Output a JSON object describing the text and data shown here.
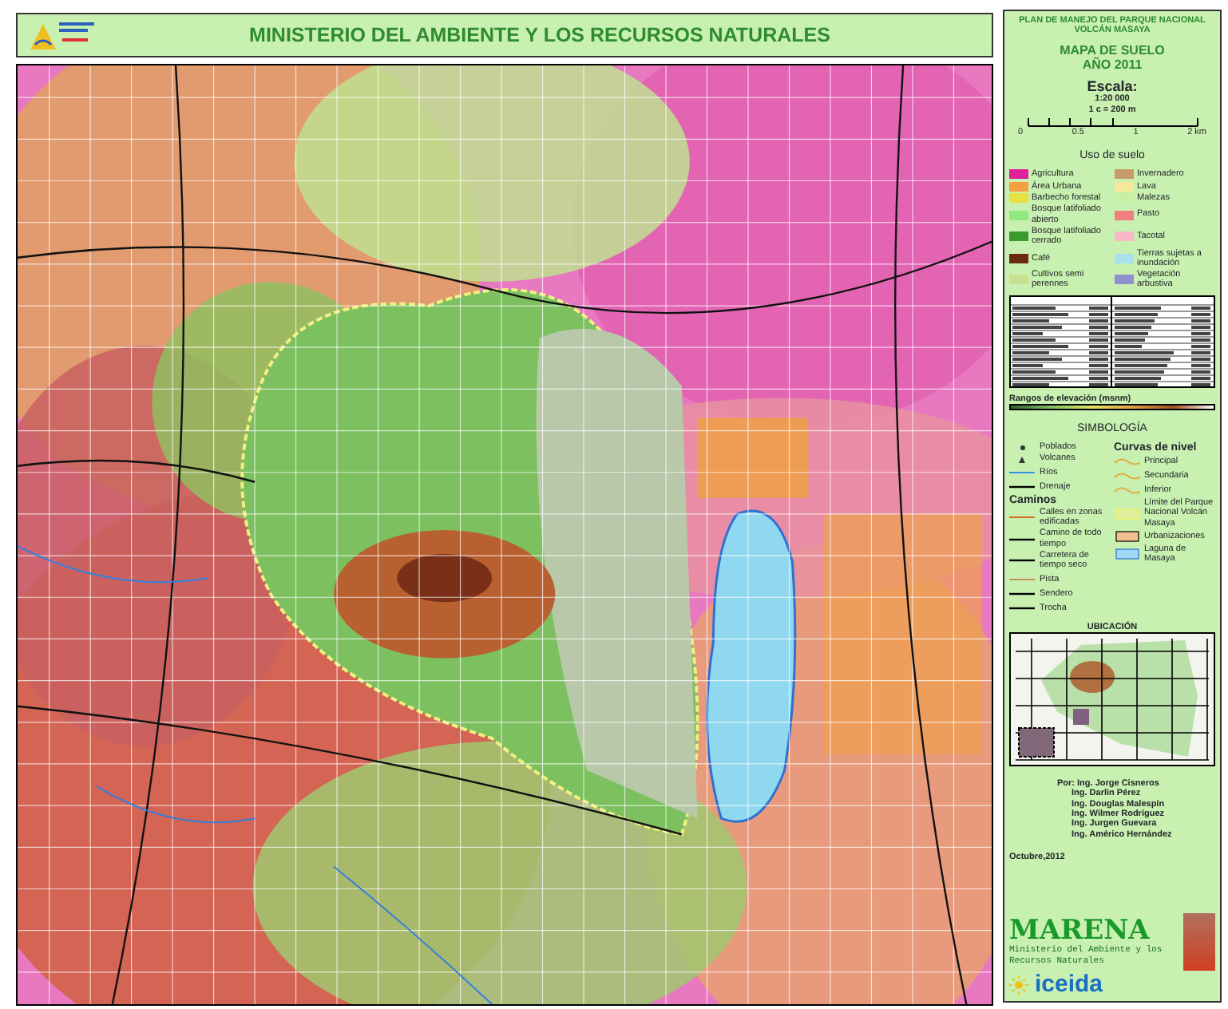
{
  "header": {
    "title": "MINISTERIO DEL AMBIENTE Y LOS RECURSOS NATURALES"
  },
  "panel": {
    "plan_title": "PLAN DE MANEJO DEL PARQUE NACIONAL VOLCÁN MASAYA",
    "map_title": "MAPA DE SUELO",
    "year": "AÑO 2011",
    "scale_label": "Escala:",
    "scale_ratio": "1:20 000",
    "scale_unit": "1 c = 200 m",
    "scale_ticks": [
      "0",
      "0.5",
      "1",
      "2 km"
    ],
    "land_use_title": "Uso de suelo",
    "land_use": [
      {
        "label": "Agricultura",
        "color": "#e0209a"
      },
      {
        "label": "Invernadero",
        "color": "#c89a6a"
      },
      {
        "label": "Área Urbana",
        "color": "#f5a040"
      },
      {
        "label": "Lava",
        "color": "#f8e89a"
      },
      {
        "label": "Barbecho forestal",
        "color": "#e8e040"
      },
      {
        "label": "Malezas",
        "color": "#c8f0a0"
      },
      {
        "label": "Bosque latifoliado abierto",
        "color": "#90e880"
      },
      {
        "label": "Pasto",
        "color": "#f08080"
      },
      {
        "label": "Bosque latifoliado cerrado",
        "color": "#3a9a30"
      },
      {
        "label": "Tacotal",
        "color": "#f8b8c8"
      },
      {
        "label": "Café",
        "color": "#6a2a10"
      },
      {
        "label": "Tierras sujetas a inundación",
        "color": "#a8e0f0"
      },
      {
        "label": "Cultivos semi perennes",
        "color": "#c8e090"
      },
      {
        "label": "Vegetación arbustiva",
        "color": "#9090d0"
      }
    ],
    "elevation_label": "Rangos de elevación (msnm)",
    "symbology_title": "SIMBOLOGÍA",
    "symbols": [
      {
        "kind": "dot",
        "label": "Poblados"
      },
      {
        "kind": "triangle",
        "label": "Volcanes"
      },
      {
        "kind": "river",
        "label": "Ríos"
      },
      {
        "kind": "line",
        "label": "Drenaje"
      }
    ],
    "roads_title": "Caminos",
    "roads": [
      {
        "kind": "street",
        "label": "Calles en zonas edificadas"
      },
      {
        "kind": "line",
        "label": "Camino de todo tiempo"
      },
      {
        "kind": "line",
        "label": "Carretera de tiempo seco"
      },
      {
        "kind": "track",
        "label": "Pista"
      },
      {
        "kind": "line",
        "label": "Sendero"
      },
      {
        "kind": "line",
        "label": "Trocha"
      }
    ],
    "contours_title": "Curvas de nivel",
    "contours": [
      {
        "kind": "contour",
        "label": "Principal"
      },
      {
        "kind": "contour",
        "label": "Secundaria"
      },
      {
        "kind": "contour",
        "label": "Inferior"
      },
      {
        "kind": "boundary",
        "label": "Límite del Parque Nacional Volcán Masaya"
      },
      {
        "kind": "urban",
        "label": "Urbanizaciones"
      },
      {
        "kind": "lake",
        "label": "Laguna de Masaya"
      }
    ],
    "location_title": "UBICACIÓN",
    "credits": [
      "Por: Ing. Jorge Cisneros",
      "Ing. Darlin Pérez",
      "Ing. Douglas Malespín",
      "Ing. Wilmer Rodríguez",
      "Ing. Jurgen Guevara",
      "Ing. Américo Hernández"
    ],
    "date": "Octubre,2012",
    "marena": "MARENA",
    "marena_sub": "Ministerio del Ambiente y los Recursos Naturales",
    "iceida": "iceida"
  }
}
